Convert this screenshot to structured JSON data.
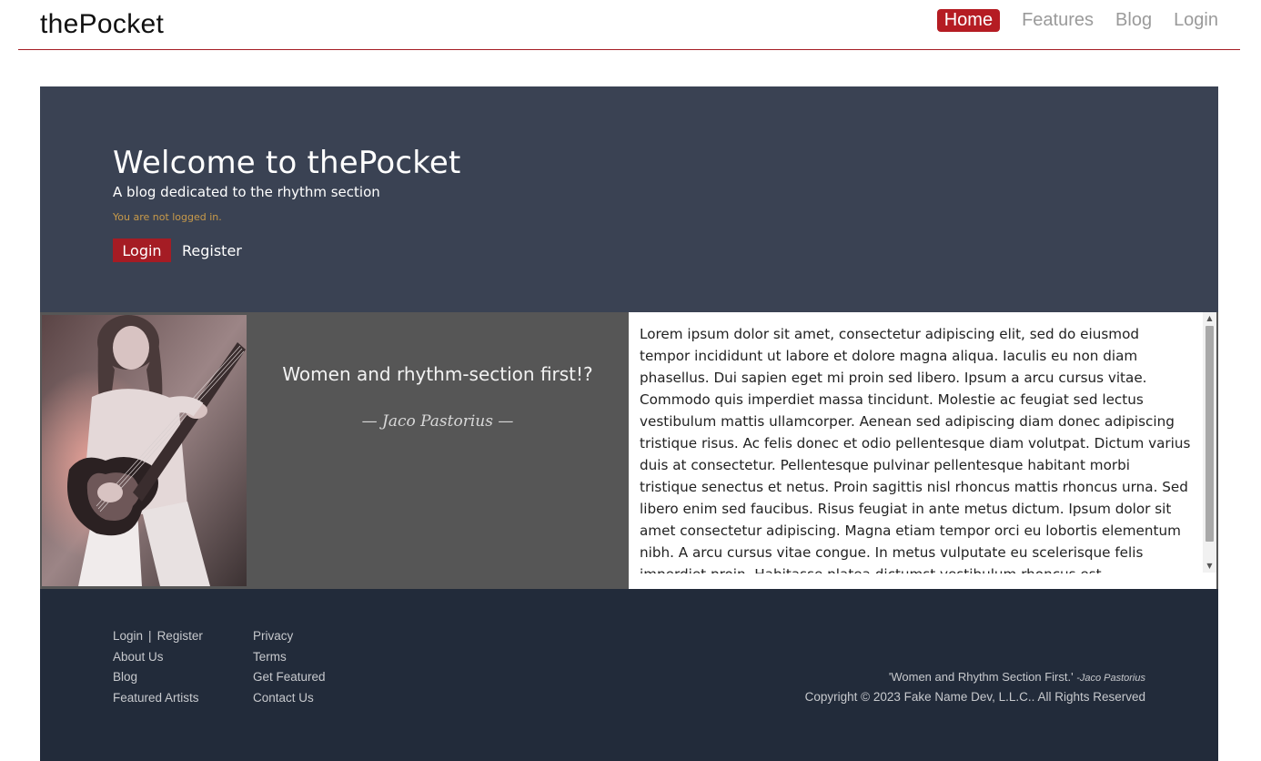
{
  "navbar": {
    "brand": "thePocket",
    "links": [
      {
        "label": "Home",
        "active": true
      },
      {
        "label": "Features",
        "active": false
      },
      {
        "label": "Blog",
        "active": false
      },
      {
        "label": "Login",
        "active": false
      }
    ]
  },
  "hero": {
    "title": "Welcome to thePocket",
    "subtitle": "A blog dedicated to the rhythm section",
    "status": "You are not logged in.",
    "login_label": "Login",
    "register_label": "Register"
  },
  "feature": {
    "quote": "Women and rhythm-section first!?",
    "author": "— Jaco Pastorius —",
    "article": "Lorem ipsum dolor sit amet, consectetur adipiscing elit, sed do eiusmod tempor incididunt ut labore et dolore magna aliqua. Iaculis eu non diam phasellus. Dui sapien eget mi proin sed libero. Ipsum a arcu cursus vitae. Commodo quis imperdiet massa tincidunt. Molestie ac feugiat sed lectus vestibulum mattis ullamcorper. Aenean sed adipiscing diam donec adipiscing tristique risus. Ac felis donec et odio pellentesque diam volutpat. Dictum varius duis at consectetur. Pellentesque pulvinar pellentesque habitant morbi tristique senectus et netus. Proin sagittis nisl rhoncus mattis rhoncus urna. Sed libero enim sed faucibus. Risus feugiat in ante metus dictum. Ipsum dolor sit amet consectetur adipiscing. Magna etiam tempor orci eu lobortis elementum nibh. A arcu cursus vitae congue. In metus vulputate eu scelerisque felis imperdiet proin. Habitasse platea dictumst vestibulum rhoncus est pellentesque elit ullamcorper."
  },
  "footer": {
    "col1": {
      "login": "Login",
      "register": "Register",
      "about": "About Us",
      "blog": "Blog",
      "featured_artists": "Featured Artists"
    },
    "col2": {
      "privacy": "Privacy",
      "terms": "Terms",
      "get_featured": "Get Featured",
      "contact": "Contact Us"
    },
    "quote": "'Women and Rhythm Section First.'",
    "quote_author": "-Jaco Pastorius",
    "copyright": "Copyright © 2023 Fake Name Dev, L.L.C.. All Rights Reserved"
  },
  "icons": {
    "scroll_up": "scroll-up-arrow",
    "scroll_down": "scroll-down-arrow"
  },
  "colors": {
    "accent": "#a51c24",
    "hero_bg": "#3a4253",
    "footer_bg": "#222b3a",
    "feature_bg": "#565656"
  }
}
